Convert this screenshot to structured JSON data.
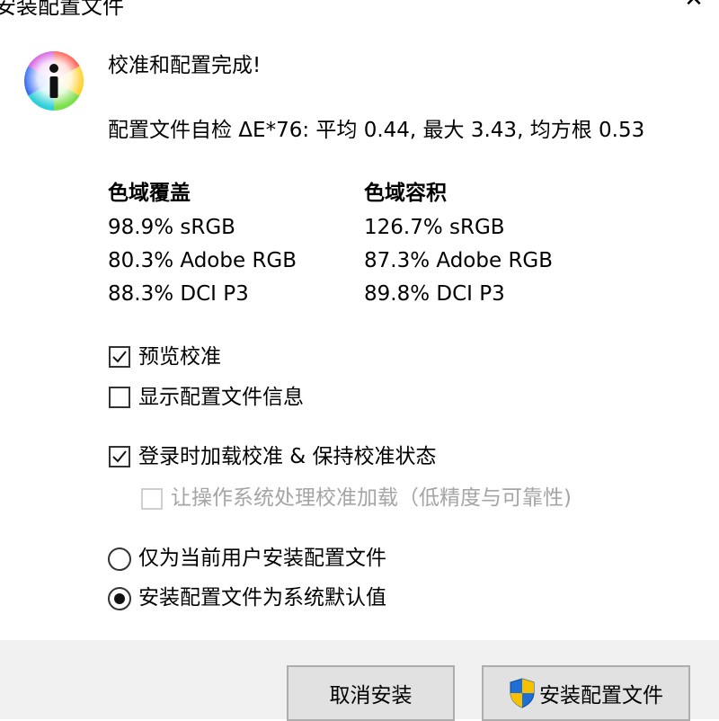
{
  "window": {
    "title": "安装配置文件",
    "close_label": "✕"
  },
  "message": {
    "heading": "校准和配置完成!",
    "self_check": "配置文件自检 ΔE*76: 平均 0.44, 最大 3.43, 均方根 0.53"
  },
  "gamut": {
    "coverage": {
      "header": "色域覆盖",
      "rows": [
        "98.9% sRGB",
        "80.3% Adobe RGB",
        "88.3% DCI P3"
      ]
    },
    "volume": {
      "header": "色域容积",
      "rows": [
        "126.7% sRGB",
        "87.3% Adobe RGB",
        "89.8% DCI P3"
      ]
    }
  },
  "options": {
    "preview": {
      "label": "预览校准",
      "checked": true
    },
    "show_info": {
      "label": "显示配置文件信息",
      "checked": false
    },
    "load_on_login": {
      "label": "登录时加载校准 & 保持校准状态",
      "checked": true
    },
    "os_handle": {
      "label": "让操作系统处理校准加载（低精度与可靠性)",
      "checked": false,
      "disabled": true
    }
  },
  "install_scope": {
    "current_user": {
      "label": "仅为当前用户安装配置文件",
      "selected": false
    },
    "system_default": {
      "label": "安装配置文件为系统默认值",
      "selected": true
    }
  },
  "buttons": {
    "cancel": "取消安装",
    "install": "安装配置文件"
  },
  "icons": {
    "info": "info-icon",
    "shield": "uac-shield-icon"
  },
  "colors": {
    "shield_blue": "#1f6fd6",
    "shield_yellow": "#f5c000",
    "button_bg": "#e1e1e1",
    "footer_bg": "#f0f0f0"
  }
}
